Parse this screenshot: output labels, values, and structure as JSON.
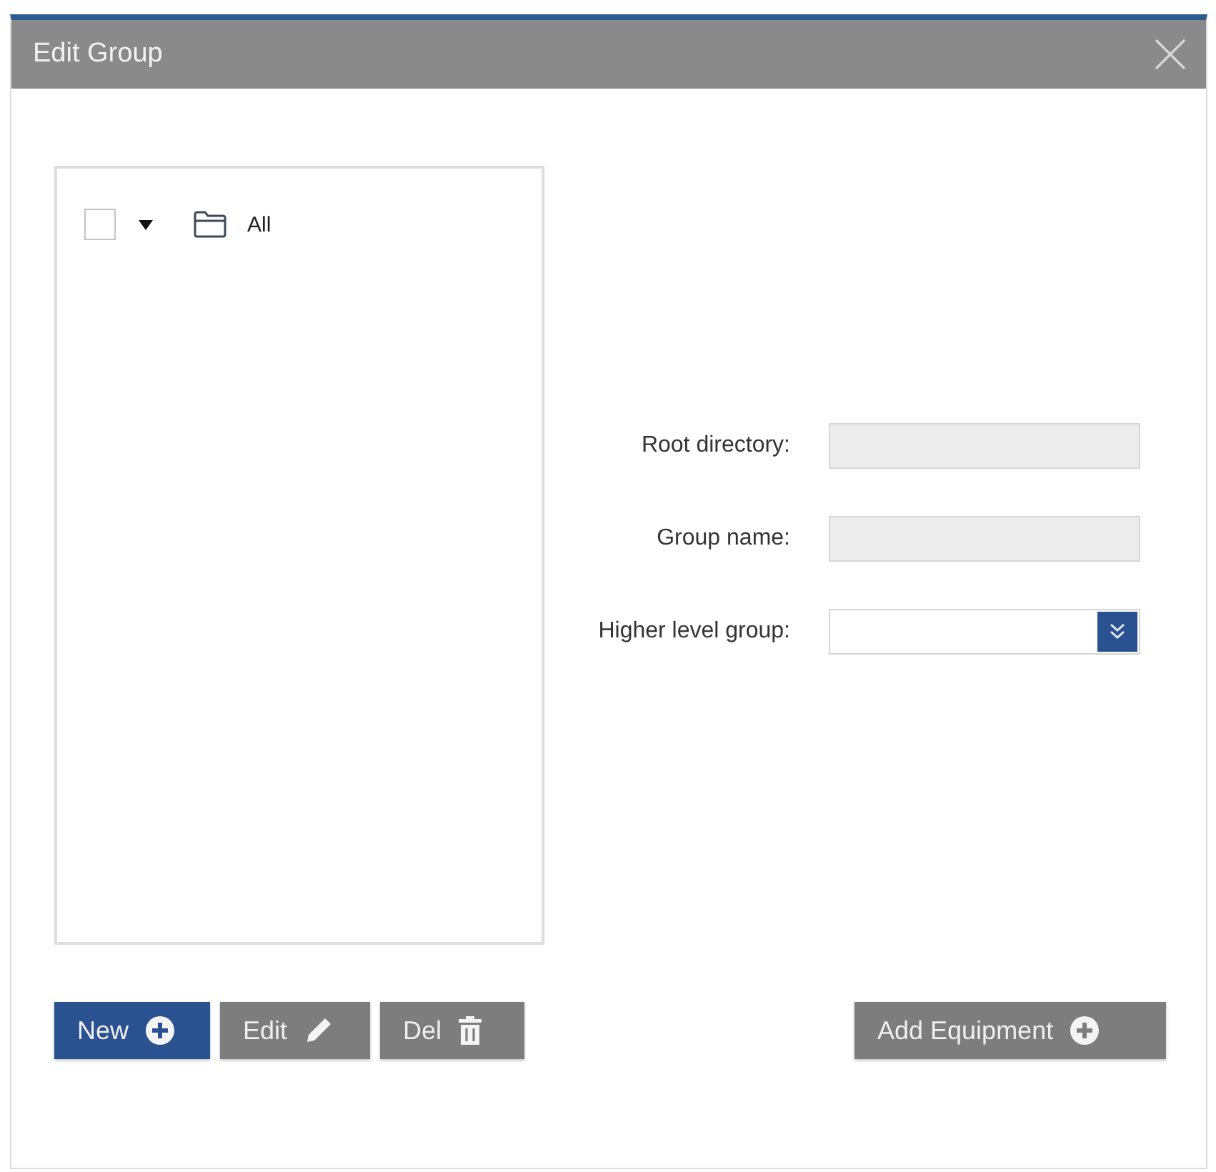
{
  "window": {
    "title": "Edit Group"
  },
  "tree": {
    "items": [
      {
        "label": "All",
        "checked": false,
        "expanded": true
      }
    ]
  },
  "form": {
    "fields": [
      {
        "label": "Root directory:",
        "kind": "text",
        "disabled": true
      },
      {
        "label": "Group name:",
        "kind": "text",
        "disabled": true
      },
      {
        "label": "Higher level group:",
        "kind": "select",
        "disabled": false
      }
    ]
  },
  "toolbar": {
    "buttons": [
      {
        "label": "New",
        "kind": "add",
        "primary": true
      },
      {
        "label": "Edit",
        "kind": "edit",
        "primary": false
      },
      {
        "label": "Del",
        "kind": "delete",
        "primary": false
      }
    ],
    "side_buttons": [
      {
        "label": "Add Equipment",
        "kind": "add",
        "primary": false
      }
    ]
  }
}
